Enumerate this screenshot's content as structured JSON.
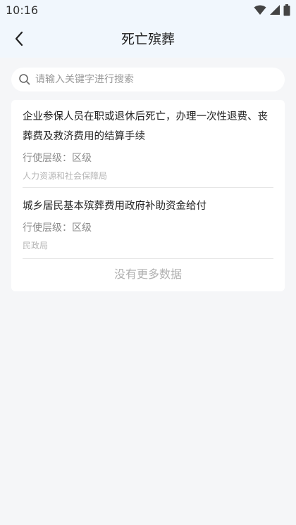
{
  "status": {
    "time": "10:16",
    "icons": [
      "wifi-icon",
      "signal-icon",
      "battery-icon"
    ]
  },
  "nav": {
    "title": "死亡殡葬",
    "back_icon": "chevron-left-icon"
  },
  "search": {
    "placeholder": "请输入关键字进行搜索",
    "value": ""
  },
  "items": [
    {
      "title": "企业参保人员在职或退休后死亡，办理一次性退费、丧葬费及救济费用的结算手续",
      "level": "行使层级：区级",
      "department": "人力资源和社会保障局"
    },
    {
      "title": "城乡居民基本殡葬费用政府补助资金给付",
      "level": "行使层级：区级",
      "department": "民政局"
    }
  ],
  "footer": {
    "no_more": "没有更多数据"
  },
  "colors": {
    "header_bg": "#f1f7fd",
    "page_bg": "#f5f6f8",
    "card_bg": "#ffffff"
  }
}
